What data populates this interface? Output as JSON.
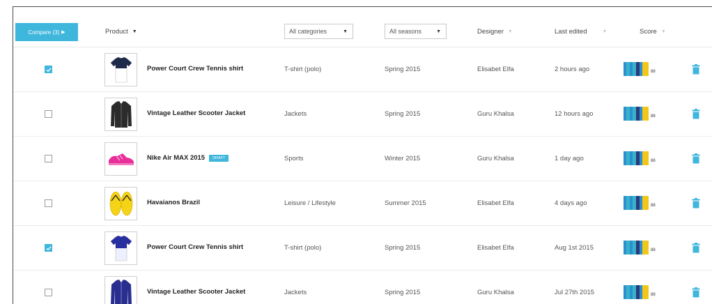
{
  "toolbar": {
    "compare_label": "Compare (3)",
    "compare_arrow": "▶"
  },
  "columns": {
    "product": "Product",
    "categories_select": "All categories",
    "seasons_select": "All seasons",
    "designer": "Designer",
    "last_edited": "Last edited",
    "score": "Score",
    "arrow_dark": "▼",
    "arrow_light": "▼"
  },
  "colors": {
    "accent": "#3fb6dc",
    "score_blue": "#2e8fd0",
    "score_teal": "#35b3c9",
    "score_navy": "#2b3a7a",
    "score_yellow": "#f2c71c"
  },
  "rows": [
    {
      "checked": true,
      "product": "Power Court Crew Tennis shirt",
      "draft": "",
      "category": "T-shirt (polo)",
      "season": "Spring 2015",
      "designer": "Elisabet Elfa",
      "edited": "2 hours ago",
      "score": "88",
      "thumb_icon": "tshirt-navy-icon"
    },
    {
      "checked": false,
      "product": "Vintage Leather Scooter Jacket",
      "draft": "",
      "category": "Jackets",
      "season": "Spring 2015",
      "designer": "Guru Khalsa",
      "edited": "12 hours ago",
      "score": "88",
      "thumb_icon": "leather-jacket-icon"
    },
    {
      "checked": false,
      "product": "Nike Air MAX 2015",
      "draft": "DRAFT",
      "category": "Sports",
      "season": "Winter 2015",
      "designer": "Guru Khalsa",
      "edited": "1 day ago",
      "score": "88",
      "thumb_icon": "sneaker-icon"
    },
    {
      "checked": false,
      "product": "Havaianos Brazil",
      "draft": "",
      "category": "Leisure / Lifestyle",
      "season": "Summer 2015",
      "designer": "Elisabet Elfa",
      "edited": "4 days ago",
      "score": "88",
      "thumb_icon": "flip-flops-icon"
    },
    {
      "checked": true,
      "product": "Power Court Crew Tennis shirt",
      "draft": "",
      "category": "T-shirt (polo)",
      "season": "Spring 2015",
      "designer": "Elisabet Elfa",
      "edited": "Aug 1st 2015",
      "score": "88",
      "thumb_icon": "tshirt-blue-icon"
    },
    {
      "checked": false,
      "product": "Vintage Leather Scooter Jacket",
      "draft": "",
      "category": "Jackets",
      "season": "Spring 2015",
      "designer": "Guru Khalsa",
      "edited": "Jul 27th 2015",
      "score": "88",
      "thumb_icon": "blue-jacket-icon"
    }
  ]
}
